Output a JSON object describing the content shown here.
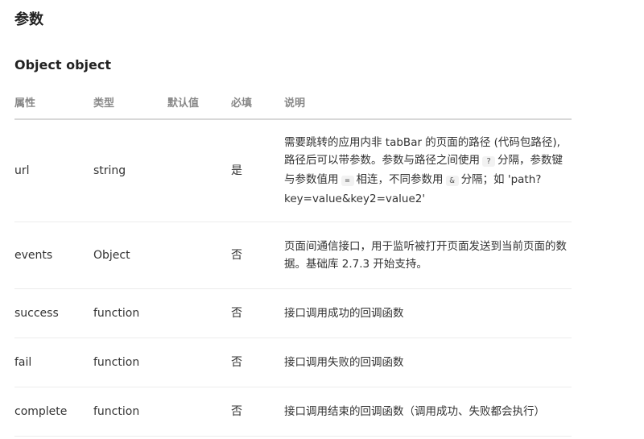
{
  "section_title": "参数",
  "sub_title": "Object object",
  "table": {
    "headers": {
      "attr": "属性",
      "type": "类型",
      "default": "默认值",
      "required": "必填",
      "desc": "说明"
    },
    "rows": [
      {
        "attr": "url",
        "type": "string",
        "default": "",
        "required": "是",
        "desc": {
          "p1": "需要跳转的应用内非 tabBar 的页面的路径 (代码包路径), 路径后可以带参数。参数与路径之间使用",
          "code1": "?",
          "p2": "分隔，参数键与参数值用",
          "code2": "=",
          "p3": "相连，不同参数用",
          "code3": "&",
          "p4": "分隔；如 'path?key=value&key2=value2'"
        }
      },
      {
        "attr": "events",
        "type": "Object",
        "default": "",
        "required": "否",
        "desc": "页面间通信接口，用于监听被打开页面发送到当前页面的数据。基础库 2.7.3 开始支持。"
      },
      {
        "attr": "success",
        "type": "function",
        "default": "",
        "required": "否",
        "desc": "接口调用成功的回调函数"
      },
      {
        "attr": "fail",
        "type": "function",
        "default": "",
        "required": "否",
        "desc": "接口调用失败的回调函数"
      },
      {
        "attr": "complete",
        "type": "function",
        "default": "",
        "required": "否",
        "desc": "接口调用结束的回调函数（调用成功、失败都会执行）"
      }
    ]
  }
}
